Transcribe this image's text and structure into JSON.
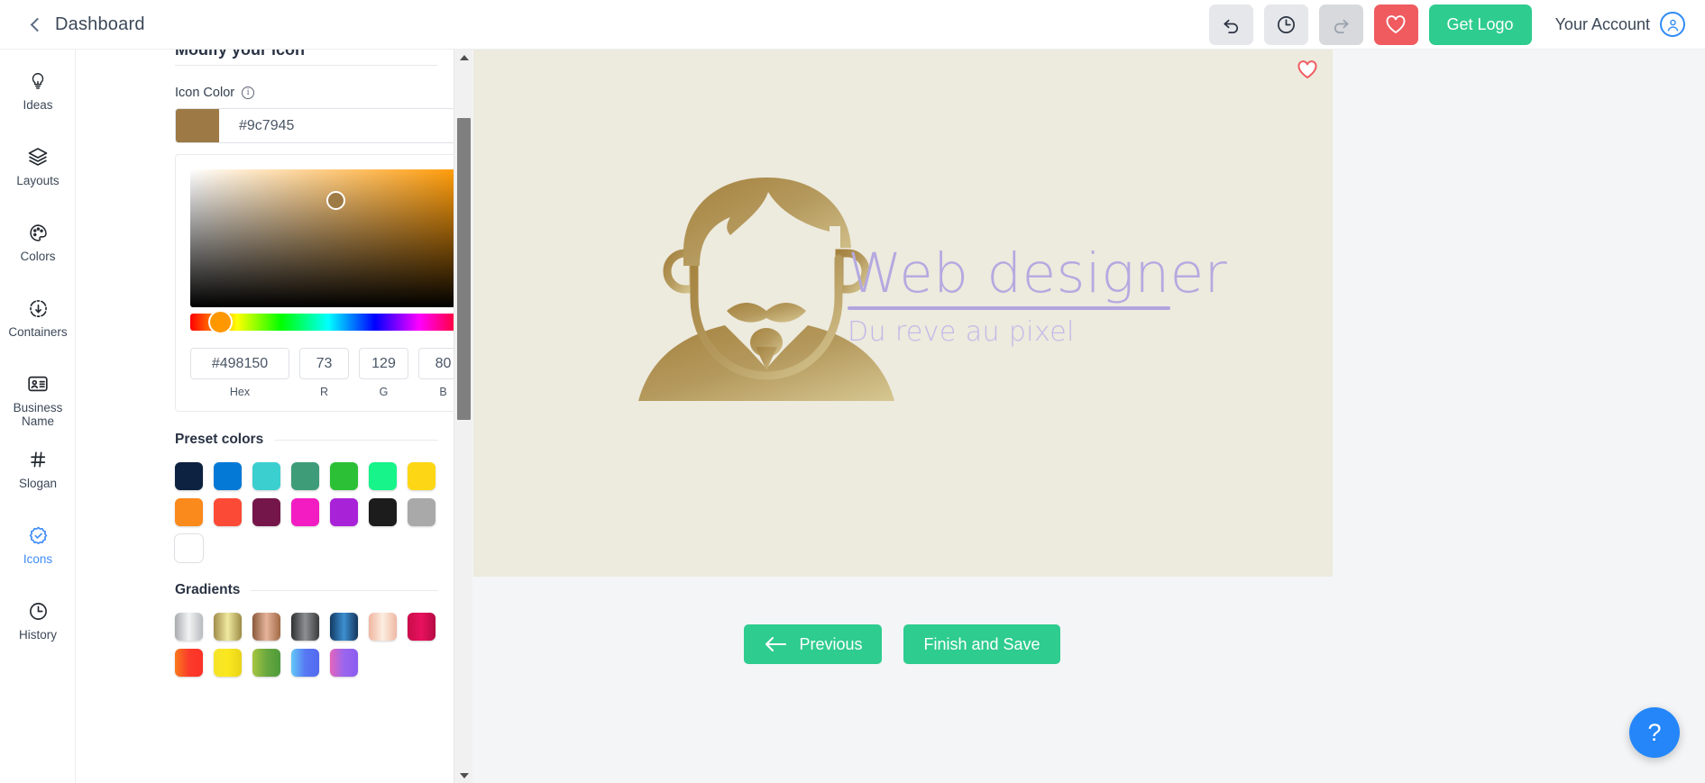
{
  "header": {
    "back_label": "Dashboard",
    "undo_icon": "undo-icon",
    "history_icon": "clock-icon",
    "redo_icon": "redo-icon",
    "favorite_icon": "heart-icon",
    "get_logo_label": "Get Logo",
    "account_label": "Your Account",
    "account_icon": "user-circle-icon"
  },
  "sidebar": {
    "items": [
      {
        "label": "Ideas",
        "icon": "lightbulb-icon",
        "active": false
      },
      {
        "label": "Layouts",
        "icon": "layers-icon",
        "active": false
      },
      {
        "label": "Colors",
        "icon": "palette-icon",
        "active": false
      },
      {
        "label": "Containers",
        "icon": "containers-icon",
        "active": false
      },
      {
        "label": "Business Name",
        "icon": "id-card-icon",
        "active": false
      },
      {
        "label": "Slogan",
        "icon": "hash-icon",
        "active": false
      },
      {
        "label": "Icons",
        "icon": "check-badge-icon",
        "active": true
      },
      {
        "label": "History",
        "icon": "clock-icon",
        "active": false
      }
    ]
  },
  "panel": {
    "heading": "Modify your icon",
    "icon_color_label": "Icon Color",
    "info_icon": "info-icon",
    "icon_color_value": "#9c7945",
    "icon_color_swatch": "#9c7945",
    "picker": {
      "hex_value": "#498150",
      "hex_caption": "Hex",
      "r_value": "73",
      "r_caption": "R",
      "g_value": "129",
      "g_caption": "G",
      "b_value": "80",
      "b_caption": "B"
    },
    "preset_colors_title": "Preset colors",
    "preset_colors": [
      "#0d2240",
      "#0579d6",
      "#3bcfd0",
      "#3e9d78",
      "#2cc037",
      "#16f48a",
      "#fdd715",
      "#fb8a1c",
      "#fb4b36",
      "#75164a",
      "#f21cc2",
      "#a822d8",
      "#1c1c1c",
      "#a9a9a9",
      "#ffffff"
    ],
    "gradients_title": "Gradients",
    "gradients": [
      "linear-gradient(to right,#a9adb0,#f2f3f4,#b8bcbf)",
      "linear-gradient(to right,#a08d4a,#f0e9a0,#9c8c46)",
      "linear-gradient(to right,#8a5a3b,#e6b49b,#a16a45)",
      "linear-gradient(to right,#2f3032,#8d9093,#3a3b3d)",
      "linear-gradient(to right,#123a63,#3d8fd0,#14355c)",
      "linear-gradient(to right,#f0b5a0,#fbeee0,#efb9a4)",
      "linear-gradient(to right,#c90c4a,#e8115d,#b60a42)",
      "linear-gradient(to right,#f97a1c,#fb3b2b,#fb3127)",
      "linear-gradient(to right,#f5e32a,#fae81f,#e9d319)",
      "linear-gradient(to right,#a7c640,#6aa840,#4d9a3a)",
      "linear-gradient(to right,#62c9f7,#5878f3,#5269f0)",
      "linear-gradient(to right,#e564bb,#9a66ee,#8a5cf0)"
    ]
  },
  "scrollbar": {
    "up_icon": "triangle-up-icon",
    "down_icon": "triangle-down-icon",
    "thumb": "scroll-thumb"
  },
  "canvas": {
    "background": "#edeade",
    "favorite_icon": "heart-outline-icon",
    "logo": {
      "title": "Web designer",
      "slogan": "Du reve au pixel",
      "text_color": "#b4a9e0",
      "icon_color": "#9c7945",
      "icon_name": "bearded-man-avatar-icon"
    }
  },
  "footer": {
    "previous_label": "Previous",
    "previous_icon": "arrow-left-icon",
    "finish_label": "Finish and Save"
  },
  "help": {
    "label": "?",
    "icon": "question-mark-icon",
    "color": "#2486f9"
  }
}
